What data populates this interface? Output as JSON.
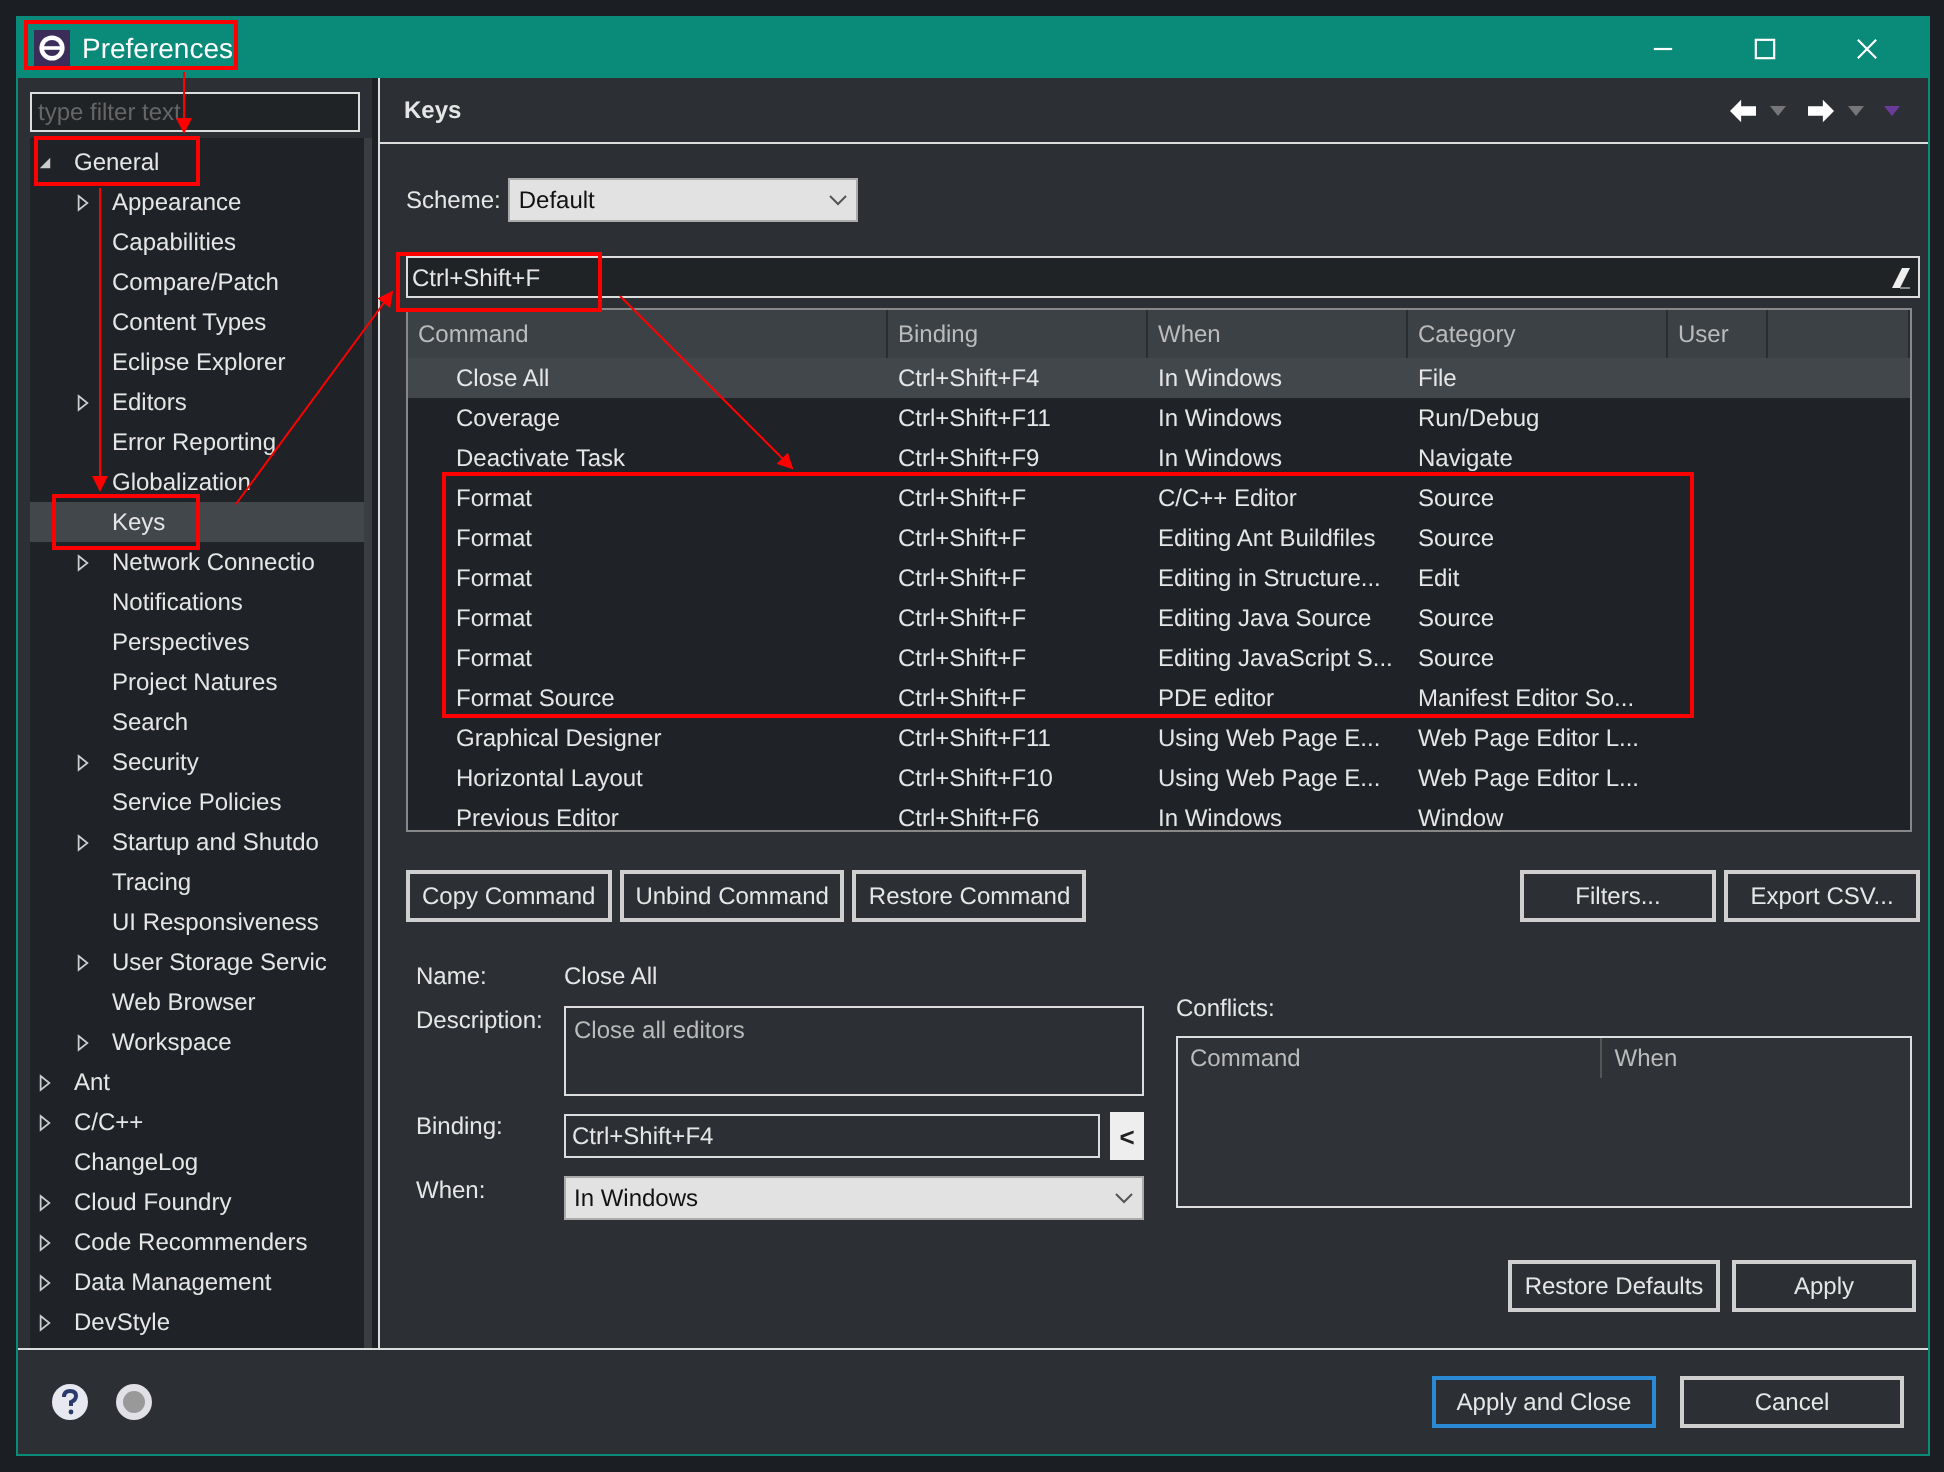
{
  "window": {
    "title": "Preferences"
  },
  "filter": {
    "placeholder": "type filter text"
  },
  "tree": [
    {
      "label": "General",
      "expanded": true,
      "selected": false,
      "children": [
        {
          "label": "Appearance",
          "expanded": false,
          "selected": false
        },
        {
          "label": "Capabilities",
          "selected": false
        },
        {
          "label": "Compare/Patch",
          "selected": false
        },
        {
          "label": "Content Types",
          "selected": false
        },
        {
          "label": "Eclipse Explorer",
          "selected": false
        },
        {
          "label": "Editors",
          "expanded": false,
          "selected": false
        },
        {
          "label": "Error Reporting",
          "selected": false
        },
        {
          "label": "Globalization",
          "selected": false
        },
        {
          "label": "Keys",
          "selected": true
        },
        {
          "label": "Network Connectio",
          "expanded": false,
          "selected": false
        },
        {
          "label": "Notifications",
          "selected": false
        },
        {
          "label": "Perspectives",
          "selected": false
        },
        {
          "label": "Project Natures",
          "selected": false
        },
        {
          "label": "Search",
          "selected": false
        },
        {
          "label": "Security",
          "expanded": false,
          "selected": false
        },
        {
          "label": "Service Policies",
          "selected": false
        },
        {
          "label": "Startup and Shutdo",
          "expanded": false,
          "selected": false
        },
        {
          "label": "Tracing",
          "selected": false
        },
        {
          "label": "UI Responsiveness",
          "selected": false
        },
        {
          "label": "User Storage Servic",
          "expanded": false,
          "selected": false
        },
        {
          "label": "Web Browser",
          "selected": false
        },
        {
          "label": "Workspace",
          "expanded": false,
          "selected": false
        }
      ]
    },
    {
      "label": "Ant",
      "expanded": false,
      "selected": false
    },
    {
      "label": "C/C++",
      "expanded": false,
      "selected": false
    },
    {
      "label": "ChangeLog",
      "selected": false
    },
    {
      "label": "Cloud Foundry",
      "expanded": false,
      "selected": false
    },
    {
      "label": "Code Recommenders",
      "expanded": false,
      "selected": false
    },
    {
      "label": "Data Management",
      "expanded": false,
      "selected": false
    },
    {
      "label": "DevStyle",
      "expanded": false,
      "selected": false
    }
  ],
  "page_title": "Keys",
  "scheme": {
    "label": "Scheme:",
    "value": "Default"
  },
  "search": {
    "value": "Ctrl+Shift+F"
  },
  "table": {
    "columns": [
      "Command",
      "Binding",
      "When",
      "Category",
      "User"
    ],
    "rows": [
      {
        "cells": [
          "Close All",
          "Ctrl+Shift+F4",
          "In Windows",
          "File"
        ],
        "selected": true
      },
      {
        "cells": [
          "Coverage",
          "Ctrl+Shift+F11",
          "In Windows",
          "Run/Debug"
        ],
        "selected": false
      },
      {
        "cells": [
          "Deactivate Task",
          "Ctrl+Shift+F9",
          "In Windows",
          "Navigate"
        ],
        "selected": false
      },
      {
        "cells": [
          "Format",
          "Ctrl+Shift+F",
          "C/C++ Editor",
          "Source"
        ],
        "selected": false
      },
      {
        "cells": [
          "Format",
          "Ctrl+Shift+F",
          "Editing Ant Buildfiles",
          "Source"
        ],
        "selected": false
      },
      {
        "cells": [
          "Format",
          "Ctrl+Shift+F",
          "Editing in Structure...",
          "Edit"
        ],
        "selected": false
      },
      {
        "cells": [
          "Format",
          "Ctrl+Shift+F",
          "Editing Java Source",
          "Source"
        ],
        "selected": false
      },
      {
        "cells": [
          "Format",
          "Ctrl+Shift+F",
          "Editing JavaScript S...",
          "Source"
        ],
        "selected": false
      },
      {
        "cells": [
          "Format Source",
          "Ctrl+Shift+F",
          "PDE editor",
          "Manifest Editor So..."
        ],
        "selected": false
      },
      {
        "cells": [
          "Graphical Designer",
          "Ctrl+Shift+F11",
          "Using Web Page E...",
          "Web Page Editor L..."
        ],
        "selected": false
      },
      {
        "cells": [
          "Horizontal Layout",
          "Ctrl+Shift+F10",
          "Using Web Page E...",
          "Web Page Editor L..."
        ],
        "selected": false
      },
      {
        "cells": [
          "Previous Editor",
          "Ctrl+Shift+F6",
          "In Windows",
          "Window"
        ],
        "selected": false
      }
    ]
  },
  "table_buttons": [
    "Copy Command",
    "Unbind Command",
    "Restore Command"
  ],
  "table_buttons_right": [
    "Filters...",
    "Export CSV..."
  ],
  "details": {
    "name_label": "Name:",
    "name": "Close All",
    "description_label": "Description:",
    "description": "Close all editors",
    "binding_label": "Binding:",
    "binding": "Ctrl+Shift+F4",
    "binding_button": "<",
    "when_label": "When:",
    "when": "In Windows"
  },
  "conflicts": {
    "label": "Conflicts:",
    "columns": [
      "Command",
      "When"
    ]
  },
  "page_buttons": [
    "Restore Defaults",
    "Apply"
  ],
  "footer_buttons": [
    {
      "label": "Apply and Close",
      "default": true
    },
    {
      "label": "Cancel",
      "default": false
    }
  ]
}
